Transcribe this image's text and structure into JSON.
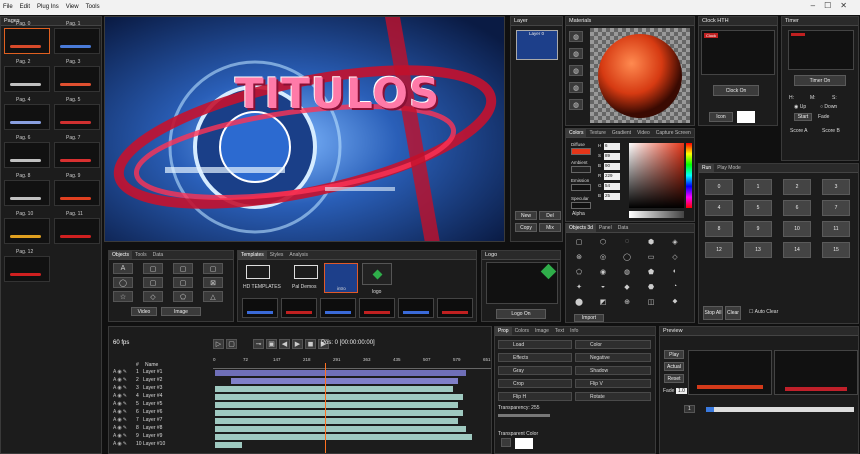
{
  "menu": [
    "File",
    "Edit",
    "Plug Ins",
    "View",
    "Tools"
  ],
  "pages": {
    "title": "Pages",
    "items": [
      "Pag. 0",
      "Pag. 1",
      "Pag. 2",
      "Pag. 3",
      "Pag. 4",
      "Pag. 5",
      "Pag. 6",
      "Pag. 7",
      "Pag. 8",
      "Pag. 9",
      "Pag. 10",
      "Pag. 11",
      "Pag. 12"
    ]
  },
  "preview": {
    "headline": "TITULOS"
  },
  "layer_panel": {
    "title": "Layer",
    "item": "Layer 0",
    "new": "New",
    "del": "Del",
    "copy": "Copy",
    "mix": "Mix"
  },
  "materials": {
    "title": "Materials"
  },
  "colors": {
    "tabs": [
      "Colors",
      "Texture",
      "Gradient",
      "Video",
      "Capture Screen"
    ],
    "materials": [
      "Diffuse",
      "Ambient",
      "Emission",
      "Specular"
    ],
    "fields": [
      {
        "k": "H",
        "v": "6"
      },
      {
        "k": "S",
        "v": "89"
      },
      {
        "k": "B",
        "v": "90"
      },
      {
        "k": "R",
        "v": "229"
      },
      {
        "k": "G",
        "v": "54"
      },
      {
        "k": "B",
        "v": "25"
      }
    ],
    "alpha": "Alpha"
  },
  "objects3d": {
    "tabs": [
      "Objects 3d",
      "Panel",
      "Data"
    ],
    "import": "Import"
  },
  "clock": {
    "title": "Clock HTH",
    "clock_on": "Clock On",
    "icon": "Icon",
    "tag": "Clock"
  },
  "timer": {
    "title": "Timer",
    "timer_on": "Timer On",
    "h": "H:",
    "m": "M:",
    "s": "S:",
    "up": "Up",
    "down": "Down",
    "start": "Start",
    "fade": "Fade",
    "scorea": "Score A",
    "scoreb": "Score B"
  },
  "run": {
    "tabs": [
      "Run",
      "Play Mode"
    ],
    "numbers": [
      "0",
      "1",
      "2",
      "3",
      "4",
      "5",
      "6",
      "7",
      "8",
      "9",
      "10",
      "11",
      "12",
      "13",
      "14",
      "15"
    ],
    "stop_all": "Stop All",
    "clear": "Clear",
    "auto_clear": "Auto Clear"
  },
  "objects": {
    "tabs": [
      "Objects",
      "Tools",
      "Data"
    ],
    "video": "Video",
    "image": "Image"
  },
  "templates": {
    "tabs": [
      "Templates",
      "Styles",
      "Analysis"
    ],
    "items": [
      "HD TEMPLATES",
      "Pal Demos",
      "intro",
      "logo"
    ]
  },
  "logo": {
    "title": "Logo",
    "logo_on": "Logo On"
  },
  "timeline": {
    "fps": "60 fps",
    "pos": "Pos: 0 [00:00:00:00]",
    "ruler": [
      "0",
      "72",
      "147",
      "218",
      "291",
      "363",
      "435",
      "507",
      "579",
      "651"
    ],
    "num_col": "#",
    "name_col": "Name",
    "layers": [
      {
        "n": "1",
        "name": "Layer #1",
        "start": 0.0,
        "end": 0.93,
        "color": "#6f6fb8"
      },
      {
        "n": "2",
        "name": "Layer #2",
        "start": 0.06,
        "end": 0.9,
        "color": "#8080c8"
      },
      {
        "n": "3",
        "name": "Layer #3",
        "start": 0.0,
        "end": 0.88,
        "color": "#9fc9c0"
      },
      {
        "n": "4",
        "name": "Layer #4",
        "start": 0.0,
        "end": 0.92,
        "color": "#9fc9c0"
      },
      {
        "n": "5",
        "name": "Layer #5",
        "start": 0.0,
        "end": 0.9,
        "color": "#9fc9c0"
      },
      {
        "n": "6",
        "name": "Layer #6",
        "start": 0.0,
        "end": 0.92,
        "color": "#9fc9c0"
      },
      {
        "n": "7",
        "name": "Layer #7",
        "start": 0.0,
        "end": 0.9,
        "color": "#9fc9c0"
      },
      {
        "n": "8",
        "name": "Layer #8",
        "start": 0.0,
        "end": 0.93,
        "color": "#9fc9c0"
      },
      {
        "n": "9",
        "name": "Layer #9",
        "start": 0.0,
        "end": 0.95,
        "color": "#9fc9c0"
      },
      {
        "n": "10",
        "name": "Layer #10",
        "start": 0.0,
        "end": 0.1,
        "color": "#9fc9c0"
      }
    ]
  },
  "props": {
    "tabs": [
      "Prop",
      "Colors",
      "Image",
      "Text",
      "Info"
    ],
    "left": [
      "Load",
      "Effects",
      "Gray",
      "Crop",
      "Flip H"
    ],
    "right": [
      "Color",
      "Negative",
      "Shadow",
      "Flip V",
      "Rotate"
    ],
    "transparency": "Transparency: 255",
    "transparent_color": "Transparent Color"
  },
  "preview_panel": {
    "title": "Preview",
    "play": "Play",
    "actual": "Actual",
    "reset": "Reset",
    "fade": "Fade",
    "fade_val": "1.0",
    "num": "1"
  }
}
